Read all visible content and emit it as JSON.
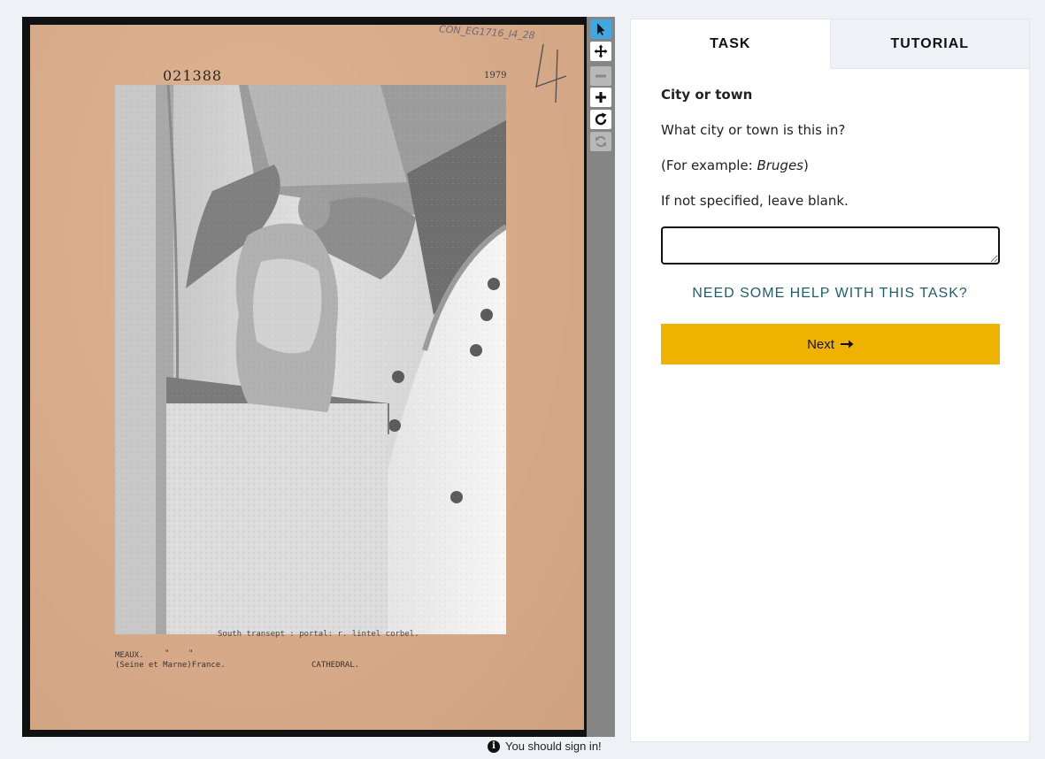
{
  "viewer": {
    "card": {
      "stamp_number": "021388",
      "stamp_year": "1979",
      "pencil_code": "CON_EG1716_I4_28",
      "pencil_number": "4",
      "caption": "South transept : portal: r. lintel corbel.",
      "location_line1": "MEAUX.",
      "location_dots": "\" \"",
      "location_line2": "(Seine et Marne)France.",
      "building_type": "CATHEDRAL."
    },
    "tools": [
      {
        "name": "pointer",
        "icon": "pointer-icon",
        "state": "active"
      },
      {
        "name": "move",
        "icon": "move-icon",
        "state": "enabled"
      },
      {
        "name": "zoom-out",
        "icon": "minus-icon",
        "state": "disabled"
      },
      {
        "name": "zoom-in",
        "icon": "plus-icon",
        "state": "enabled"
      },
      {
        "name": "rotate",
        "icon": "rotate-icon",
        "state": "enabled"
      },
      {
        "name": "reset",
        "icon": "refresh-icon",
        "state": "disabled"
      }
    ],
    "signin_text": "You should sign in!"
  },
  "panel": {
    "tabs": [
      {
        "label": "TASK",
        "active": true
      },
      {
        "label": "TUTORIAL",
        "active": false
      }
    ],
    "task": {
      "title": "City or town",
      "question": "What city or town is this in?",
      "example_prefix": "(For example: ",
      "example_value": "Bruges",
      "example_suffix": ")",
      "instruction": "If not specified, leave blank.",
      "answer_value": "",
      "help_link": "NEED SOME HELP WITH THIS TASK?",
      "next_label": "Next",
      "next_icon": "arrow-right-icon"
    }
  },
  "colors": {
    "accent_button": "#eeb200",
    "help_link": "#1f5f6a",
    "active_tool": "#40a8e0",
    "card_background": "#d8ae8c"
  }
}
